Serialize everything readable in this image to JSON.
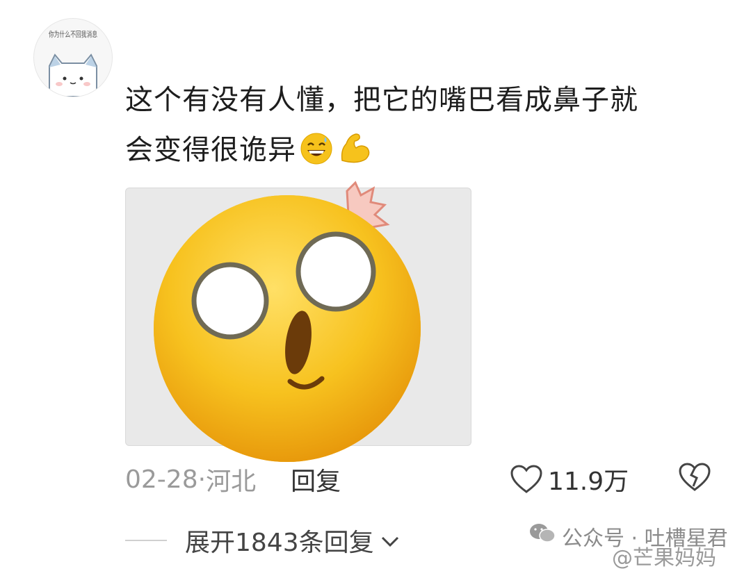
{
  "avatar": {
    "caption": "你为什么不回我消息"
  },
  "comment": {
    "line1": "这个有没有人懂，把它的嘴巴看成鼻子就",
    "line2": "会变得很诡异"
  },
  "meta": {
    "date": "02-28",
    "separator": " · ",
    "location": "河北",
    "reply_label": "回复"
  },
  "like": {
    "count": "11.9万"
  },
  "expand": {
    "label": "展开1843条回复"
  },
  "watermark": {
    "account": "公众号 · 吐槽星君",
    "handle": "@芒果妈妈"
  },
  "colors": {
    "emoji_yellow": "#f6c21c",
    "text": "#1d1d1d",
    "meta_gray": "#9a9a9a"
  }
}
